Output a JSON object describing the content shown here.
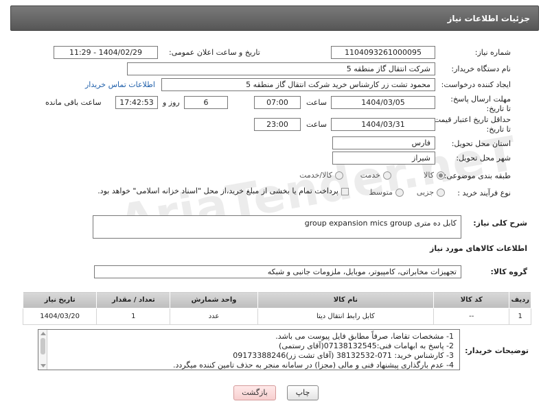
{
  "header": {
    "title": "جزئیات اطلاعات نیاز"
  },
  "fields": {
    "need_number_label": "شماره نیاز:",
    "need_number": "1104093261000095",
    "announce_datetime_label": "تاریخ و ساعت اعلان عمومی:",
    "announce_datetime": "1404/02/29 - 11:29",
    "buyer_org_label": "نام دستگاه خریدار:",
    "buyer_org": "شرکت انتقال گاز منطقه 5",
    "requester_label": "ایجاد کننده درخواست:",
    "requester": "محمود تشت زر کارشناس خرید شرکت انتقال گاز منطقه 5",
    "buyer_contact_link": "اطلاعات تماس خریدار",
    "reply_deadline_label": "مهلت ارسال پاسخ: تا تاریخ:",
    "reply_date": "1404/03/05",
    "time_label": "ساعت",
    "reply_time": "07:00",
    "days_value": "6",
    "days_label": "روز و",
    "remaining_time": "17:42:53",
    "remaining_label": "ساعت باقی مانده",
    "price_validity_label": "حداقل تاریخ اعتبار قیمت: تا تاریخ:",
    "price_date": "1404/03/31",
    "price_time": "23:00",
    "province_label": "استان محل تحویل:",
    "province": "فارس",
    "city_label": "شهر محل تحویل:",
    "city": "شیراز",
    "category_label": "طبقه بندی موضوعی:",
    "category_options": [
      "کالا",
      "خدمت",
      "کالا/خدمت"
    ],
    "process_label": "نوع فرآیند خرید :",
    "process_options": [
      "جزیی",
      "متوسط"
    ],
    "payment_note": "پرداخت تمام یا بخشی از مبلغ خرید،از محل \"اسناد خزانه اسلامی\" خواهد بود."
  },
  "description": {
    "label": "شرح کلی نیاز:",
    "value": "کابل ده متری group expansion mics group"
  },
  "goods_section": {
    "title": "اطلاعات کالاهای مورد نیاز",
    "group_label": "گروه کالا:",
    "group_value": "تجهیزات مخابراتی، کامپیوتر، موبایل، ملزومات جانبی و شبکه"
  },
  "table": {
    "headers": [
      "ردیف",
      "کد کالا",
      "نام کالا",
      "واحد شمارش",
      "تعداد / مقدار",
      "تاریخ نیاز"
    ],
    "rows": [
      [
        "1",
        "--",
        "کابل رابط انتقال دیتا",
        "عدد",
        "1",
        "1404/03/20"
      ]
    ]
  },
  "buyer_notes": {
    "label": "توضیحات خریدار:",
    "lines": [
      "1-  مشخصات تقاضا، صرفاً مطابق فایل پیوست می باشد.",
      "2- پاسخ به ابهامات فنی:07138132545(آقای رستمی)",
      "3- کارشناس خرید: 071-38132532 (آقای تشت زر)09173388246",
      "4- عدم بارگذاری پیشنهاد فنی و مالی (مجزا) در سامانه منجر به حذف تامین کننده میگردد."
    ]
  },
  "buttons": {
    "print": "چاپ",
    "back": "بازگشت"
  },
  "watermark": "AriaTender.neT"
}
